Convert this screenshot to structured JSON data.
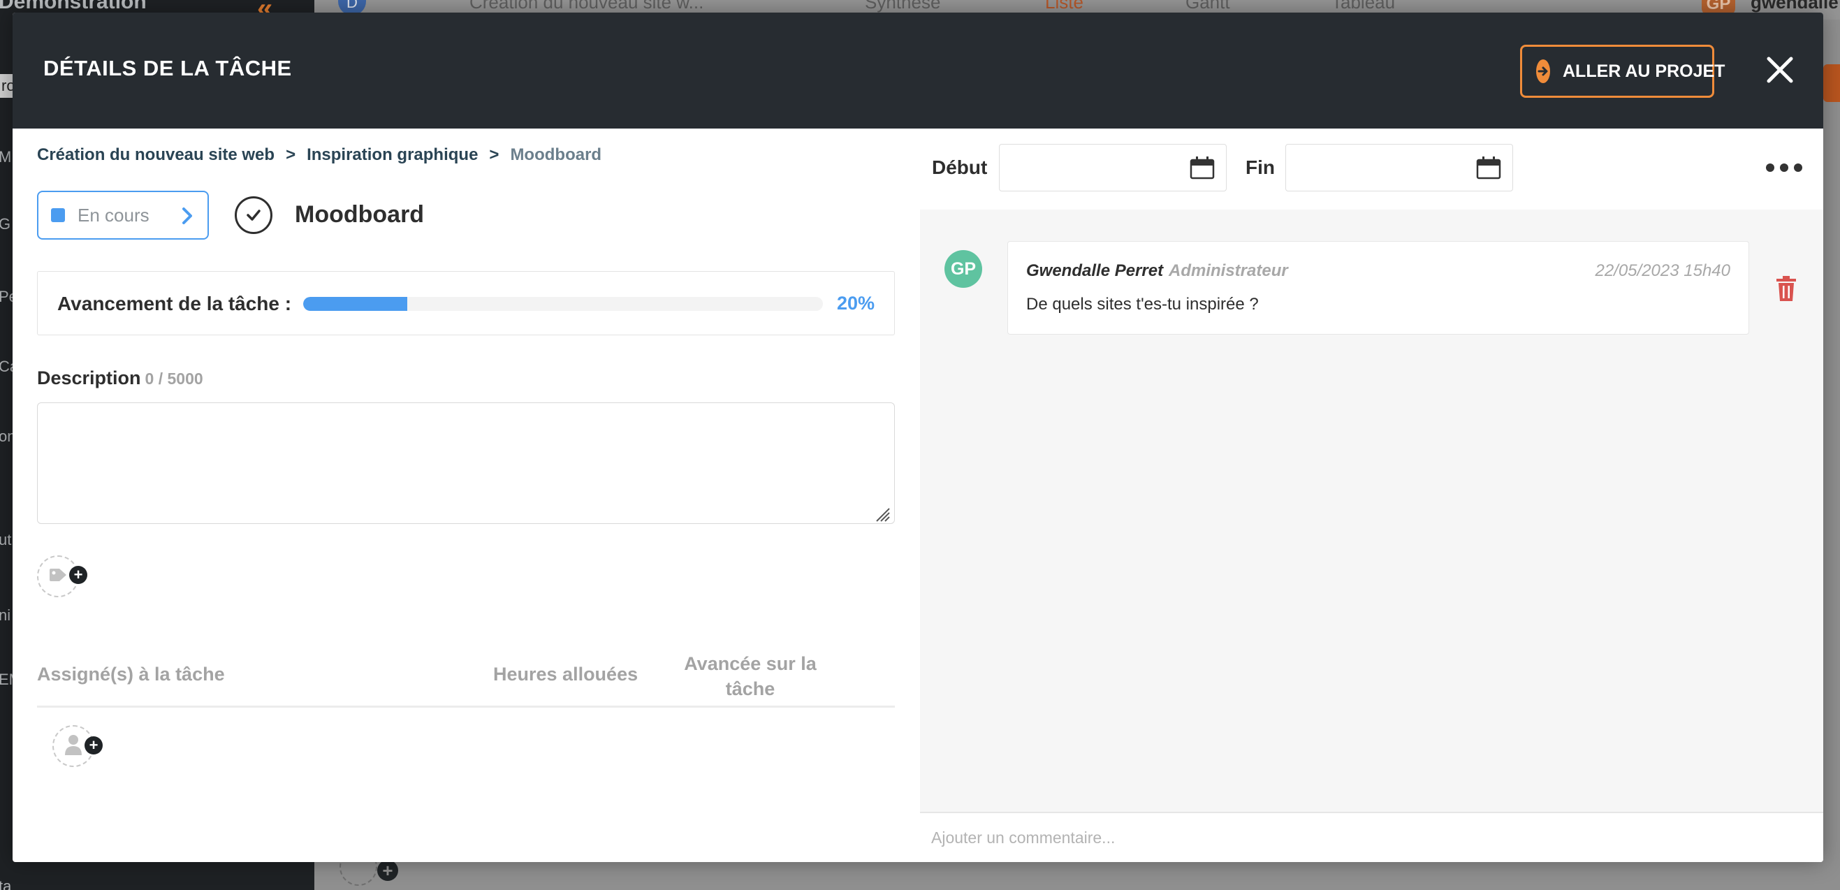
{
  "background": {
    "sidebar_title": "Démonstration",
    "sidebar_fragments": [
      "ro",
      "M",
      "G",
      "Pe",
      "Ca",
      "on",
      "ut",
      "ni",
      "EM",
      "ta"
    ],
    "project_select": "Création du nouveau site w...",
    "avatar_left": "D",
    "views": [
      "Synthèse",
      "Liste",
      "Gantt",
      "Tableau"
    ],
    "user_initials": "GP",
    "user_name": "gwendalle"
  },
  "modal": {
    "title": "DÉTAILS DE LA TÂCHE",
    "goto_label": "ALLER AU PROJET",
    "breadcrumb": [
      "Création du nouveau site web",
      "Inspiration graphique",
      "Moodboard"
    ],
    "breadcrumb_sep": ">",
    "status_label": "En cours",
    "task_title": "Moodboard",
    "progress_label": "Avancement de la tâche :",
    "progress_value": 0.2,
    "progress_text": "20%",
    "description_label": "Description",
    "description_count": "0 / 5000",
    "description_value": "",
    "table_headers": {
      "assignees": "Assigné(s) à la tâche",
      "hours": "Heures allouées",
      "progress": "Avancée sur la tâche"
    },
    "date_start_label": "Début",
    "date_end_label": "Fin",
    "comments": [
      {
        "initials": "GP",
        "author": "Gwendalle Perret",
        "role": "Administrateur",
        "date": "22/05/2023 15h40",
        "text": "De quels sites t'es-tu inspirée ?"
      }
    ],
    "comment_placeholder": "Ajouter un commentaire...",
    "colors": {
      "accent_orange": "#f08c3a",
      "status_blue": "#4b9cf0",
      "avatar_green": "#5fc3a0",
      "delete_red": "#d9534f"
    }
  }
}
